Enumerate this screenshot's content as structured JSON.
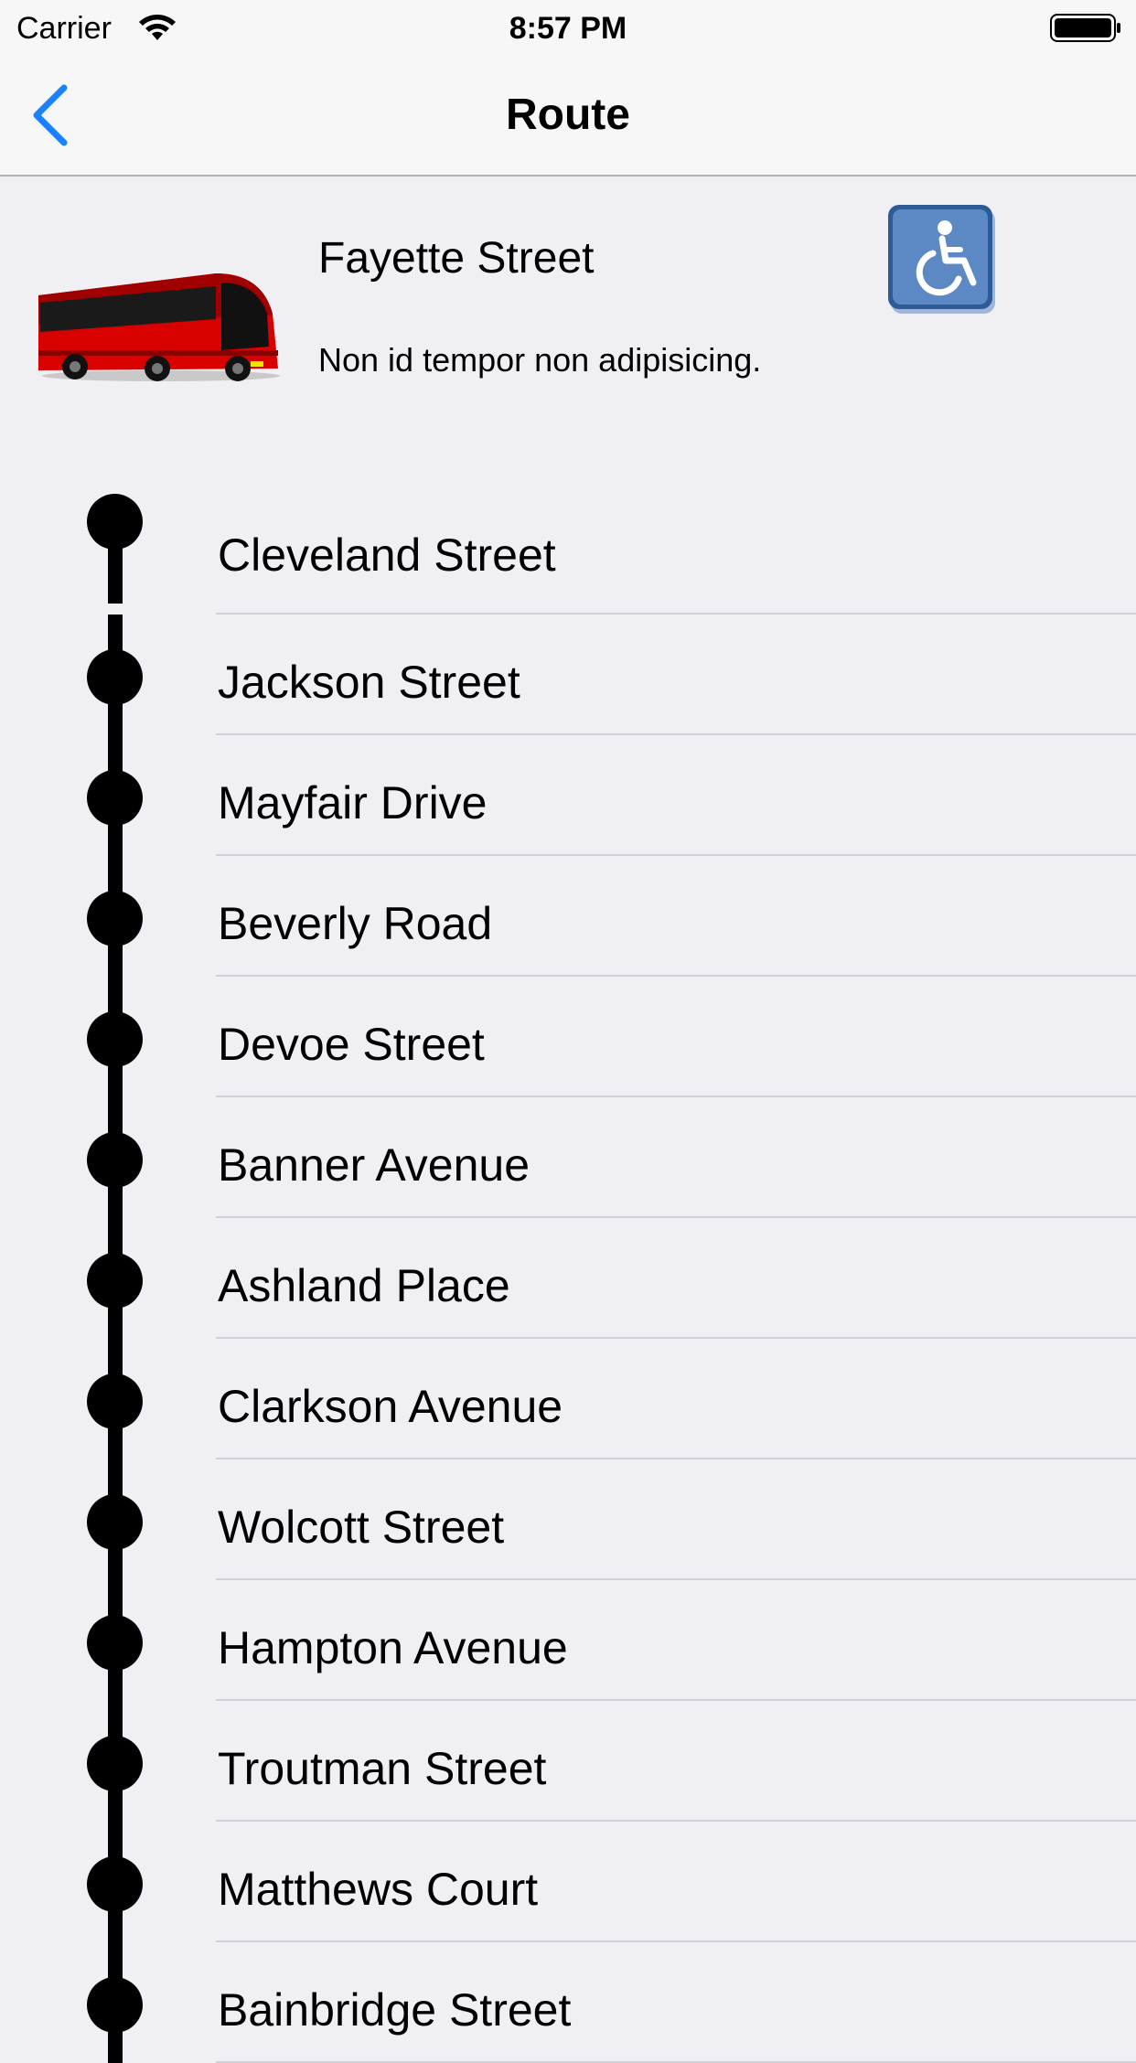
{
  "status_bar": {
    "carrier": "Carrier",
    "time": "8:57 PM"
  },
  "nav": {
    "title": "Route",
    "back_icon": "chevron-left-icon",
    "accent": "#1a82fb"
  },
  "route": {
    "name": "Fayette Street",
    "description": "Non id tempor non adipisicing.",
    "badge_icon": "wheelchair-accessible-icon",
    "badge_color": "#4f7fbf",
    "bus_color": "#e00000"
  },
  "stops": [
    "Cleveland Street",
    "Jackson Street",
    "Mayfair Drive",
    "Beverly Road",
    "Devoe Street",
    "Banner Avenue",
    "Ashland Place",
    "Clarkson Avenue",
    "Wolcott Street",
    "Hampton Avenue",
    "Troutman Street",
    "Matthews Court",
    "Bainbridge Street"
  ]
}
